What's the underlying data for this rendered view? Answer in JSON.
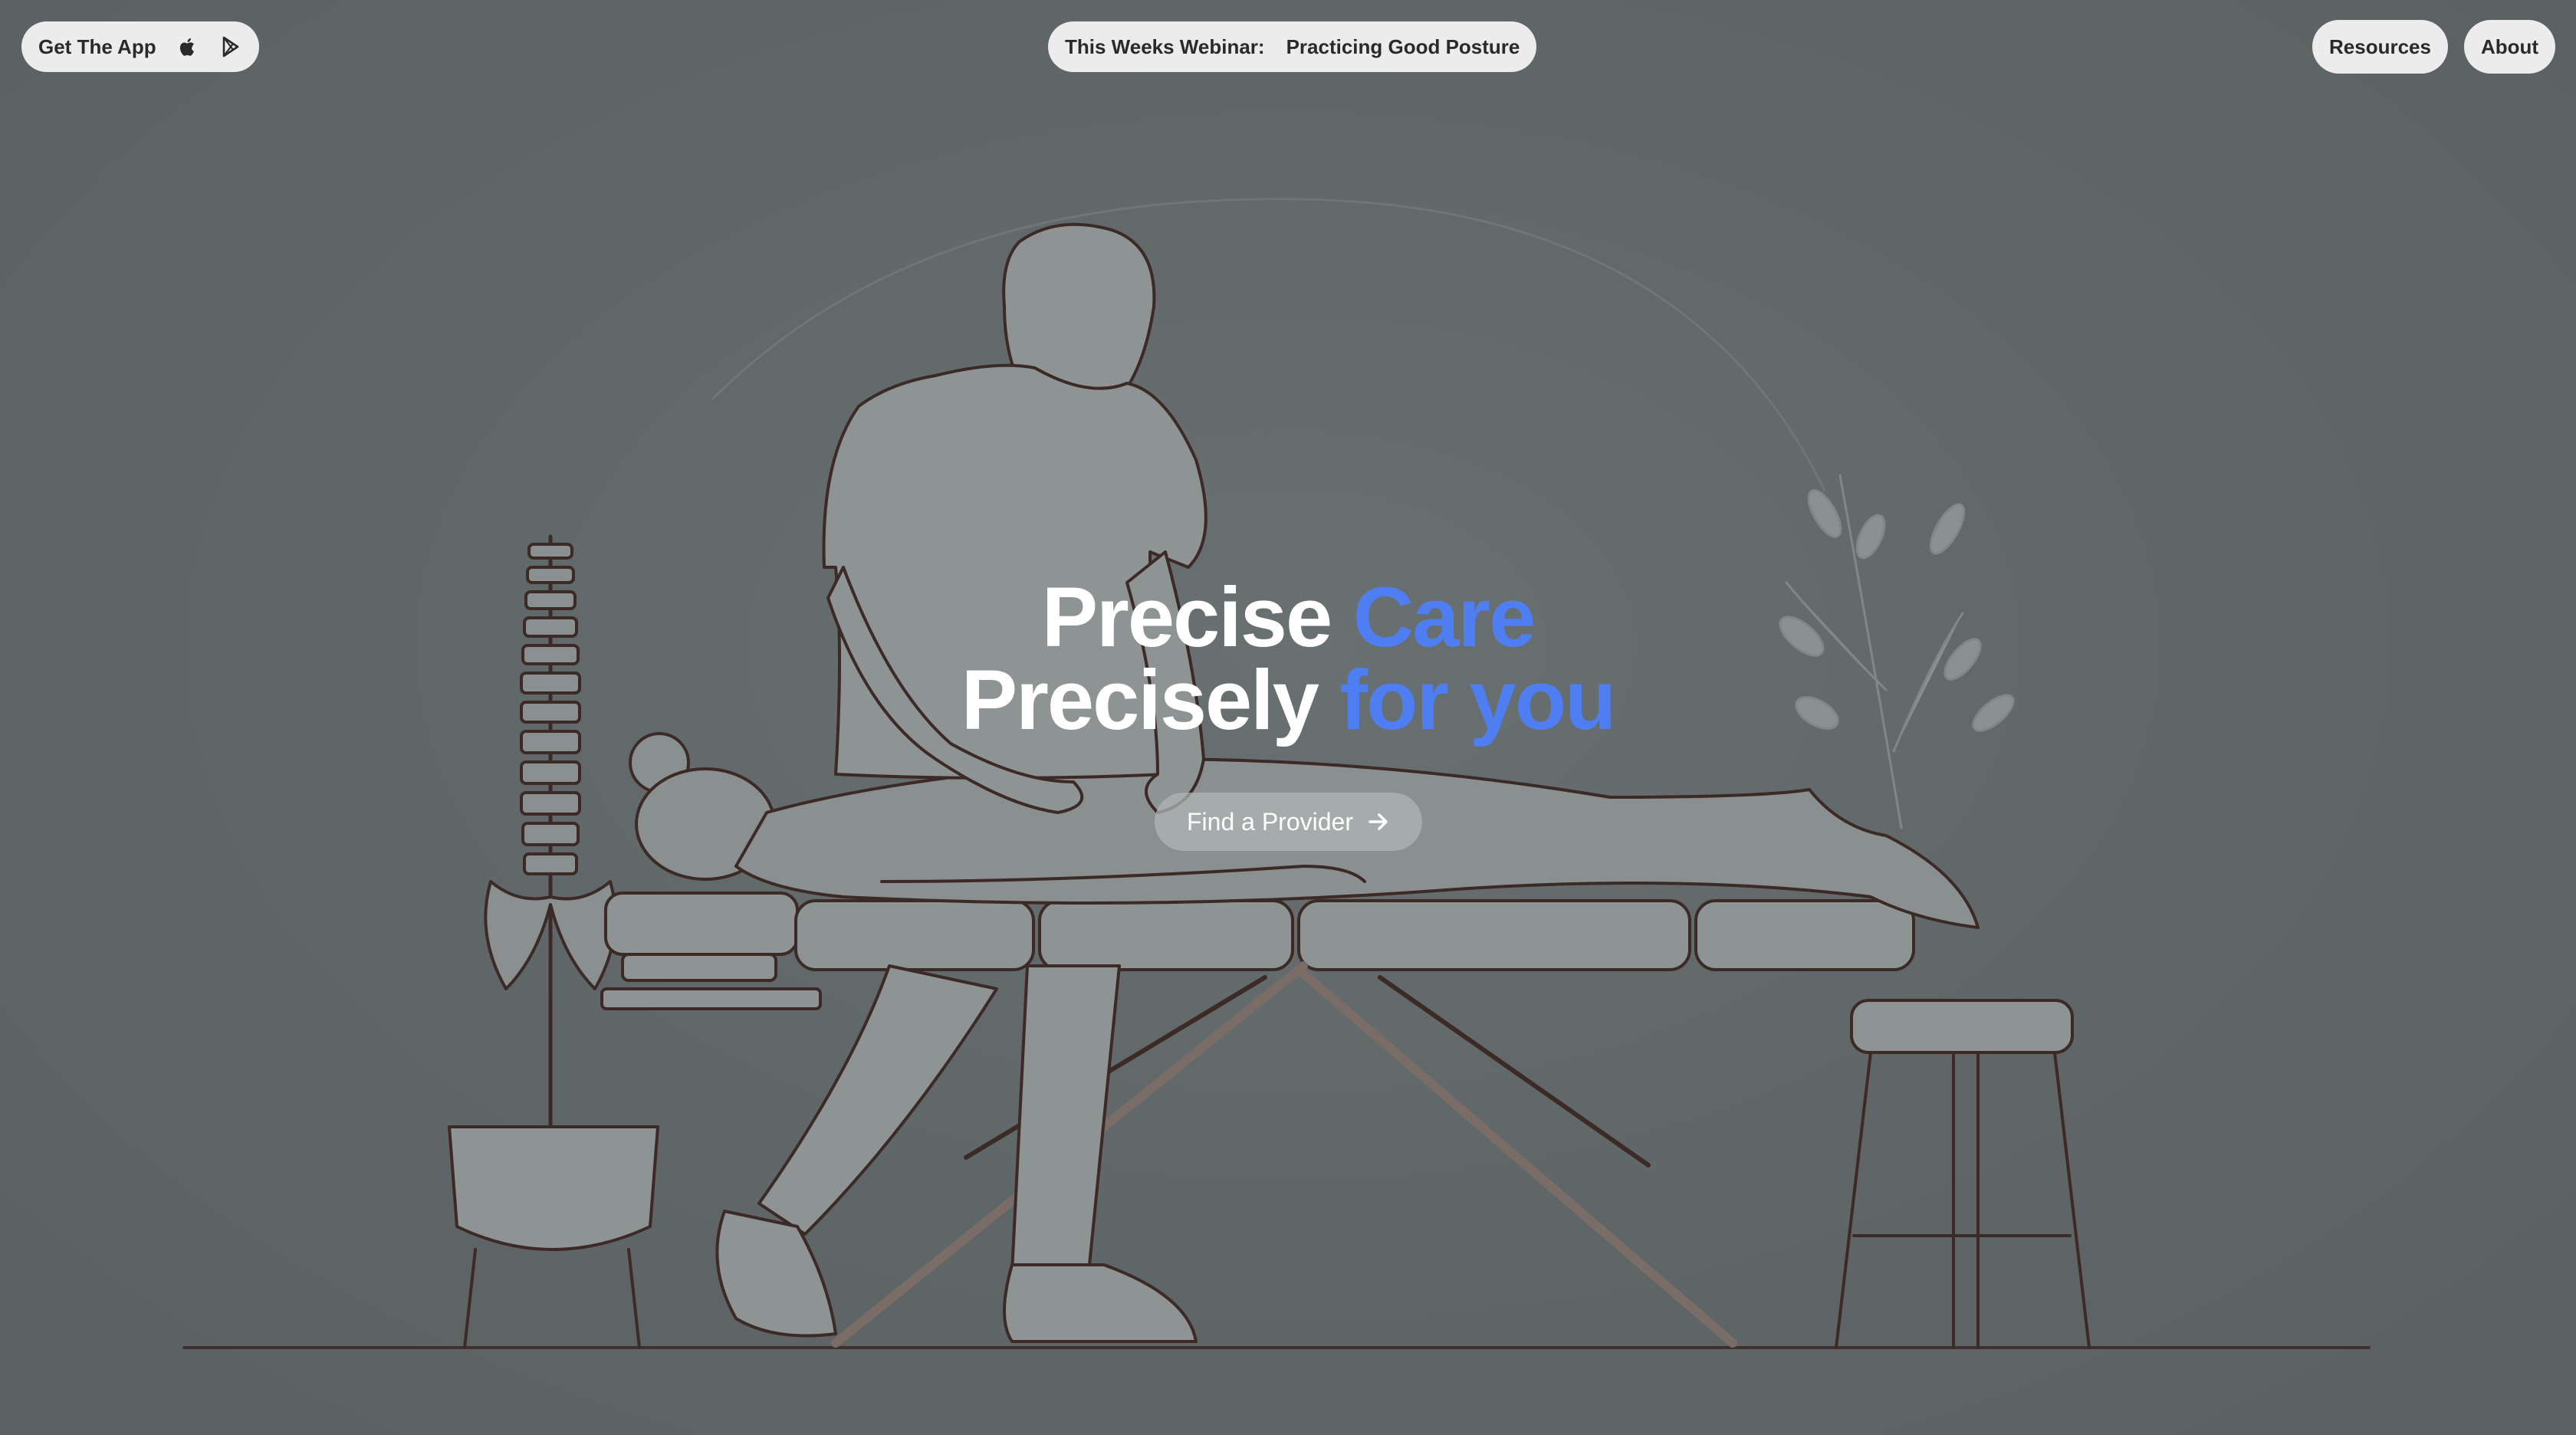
{
  "nav": {
    "get_app_label": "Get The App",
    "apple_icon": "apple-icon",
    "play_icon": "google-play-icon",
    "webinar_prefix": "This Weeks Webinar:",
    "webinar_title": "Practicing Good Posture",
    "resources_label": "Resources",
    "about_label": "About"
  },
  "hero": {
    "line1_white": "Precise",
    "line1_accent": "Care",
    "line2_white": "Precisely",
    "line2_accent": "for you",
    "accent_color": "#4f7ef2",
    "cta_label": "Find a Provider",
    "cta_icon": "arrow-right-icon"
  },
  "background": {
    "illustration": "massage-therapy-illustration"
  }
}
